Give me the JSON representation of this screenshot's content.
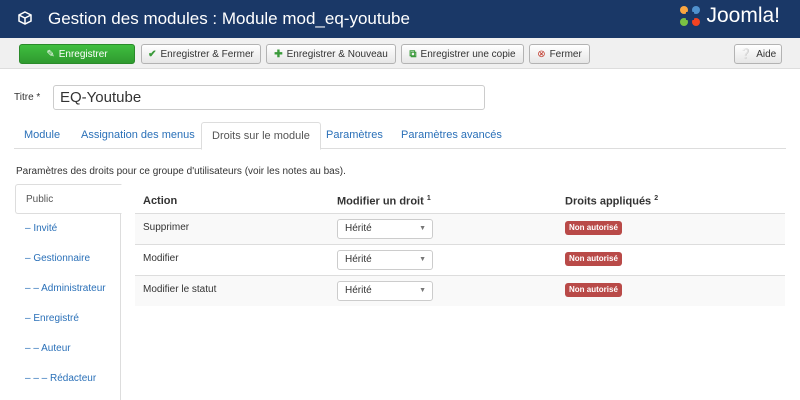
{
  "header": {
    "title": "Gestion des modules : Module mod_eq-youtube",
    "logo_text": "Joomla!"
  },
  "toolbar": {
    "save": "Enregistrer",
    "save_close": "Enregistrer & Fermer",
    "save_new": "Enregistrer & Nouveau",
    "save_copy": "Enregistrer une copie",
    "close": "Fermer",
    "help": "Aide"
  },
  "form": {
    "title_label": "Titre *",
    "title_value": "EQ-Youtube"
  },
  "tabs": [
    "Module",
    "Assignation des menus",
    "Droits sur le module",
    "Paramètres",
    "Paramètres avancés"
  ],
  "active_tab": "Droits sur le module",
  "permissions": {
    "description": "Paramètres des droits pour ce groupe d'utilisateurs (voir les notes au bas).",
    "groups": [
      "Public",
      "– Invité",
      "– Gestionnaire",
      "– – Administrateur",
      "– Enregistré",
      "– – Auteur",
      "– – – Rédacteur"
    ],
    "active_group": "Public",
    "columns": {
      "action": "Action",
      "modify": "Modifier un droit",
      "modify_note": "1",
      "applied": "Droits appliqués",
      "applied_note": "2"
    },
    "rows": [
      {
        "action": "Supprimer",
        "setting": "Hérité",
        "applied": "Non autorisé"
      },
      {
        "action": "Modifier",
        "setting": "Hérité",
        "applied": "Non autorisé"
      },
      {
        "action": "Modifier le statut",
        "setting": "Hérité",
        "applied": "Non autorisé"
      }
    ]
  },
  "colors": {
    "header_bg": "#1a3867",
    "save_green": "#3fbe3f",
    "badge_red": "#b94a48",
    "link_blue": "#2a70b8"
  }
}
